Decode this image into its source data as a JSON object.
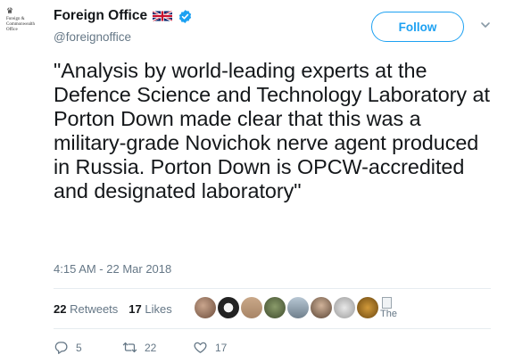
{
  "author": {
    "name": "Foreign Office",
    "handle": "@foreignoffice",
    "logo_text": "Foreign & Commonwealth Office",
    "verified": true,
    "flag_icon": "uk-flag-icon"
  },
  "follow_button": {
    "label": "Follow"
  },
  "tweet": {
    "text": "\"Analysis by world-leading experts at the Defence Science and Technology Laboratory at Porton Down made clear that this was a military-grade Novichok nerve agent produced in Russia. Porton Down is OPCW-accredited and designated laboratory\"",
    "timestamp": "4:15 AM - 22 Mar 2018"
  },
  "stats": {
    "retweets_count": "22",
    "retweets_label": "Retweets",
    "likes_count": "17",
    "likes_label": "Likes",
    "broken_avatar_alt": "The"
  },
  "actions": {
    "replies": "5",
    "retweets": "22",
    "likes": "17"
  },
  "colors": {
    "accent": "#1da1f2",
    "secondary_text": "#657786",
    "primary_text": "#14171a",
    "divider": "#e6ecf0"
  }
}
